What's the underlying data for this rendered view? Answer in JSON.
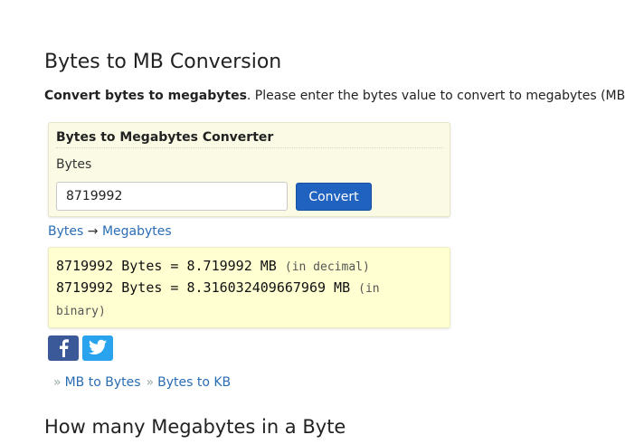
{
  "page": {
    "title": "Bytes to MB Conversion",
    "intro_bold": "Convert bytes to megabytes",
    "intro_rest": ". Please enter the bytes value to convert to megabytes (MB)."
  },
  "converter": {
    "title": "Bytes to Megabytes Converter",
    "input_label": "Bytes",
    "input_value": "8719992",
    "button_label": "Convert"
  },
  "direction": {
    "from": "Bytes",
    "arrow": "→",
    "to": "Megabytes"
  },
  "result": {
    "line1_main": "8719992 Bytes = 8.719992 MB",
    "line1_note": "(in decimal)",
    "line2_main": "8719992 Bytes = 8.316032409667969 MB",
    "line2_note_a": "(in",
    "line2_note_b": "binary)"
  },
  "share": {
    "facebook_icon": "facebook-icon",
    "twitter_icon": "twitter-icon",
    "facebook_color": "#3b5998",
    "twitter_color": "#2aa3ef"
  },
  "related": {
    "separator": "»",
    "links": [
      "MB to Bytes",
      "Bytes to KB"
    ]
  },
  "section2": {
    "title": "How many Megabytes in a Byte"
  }
}
